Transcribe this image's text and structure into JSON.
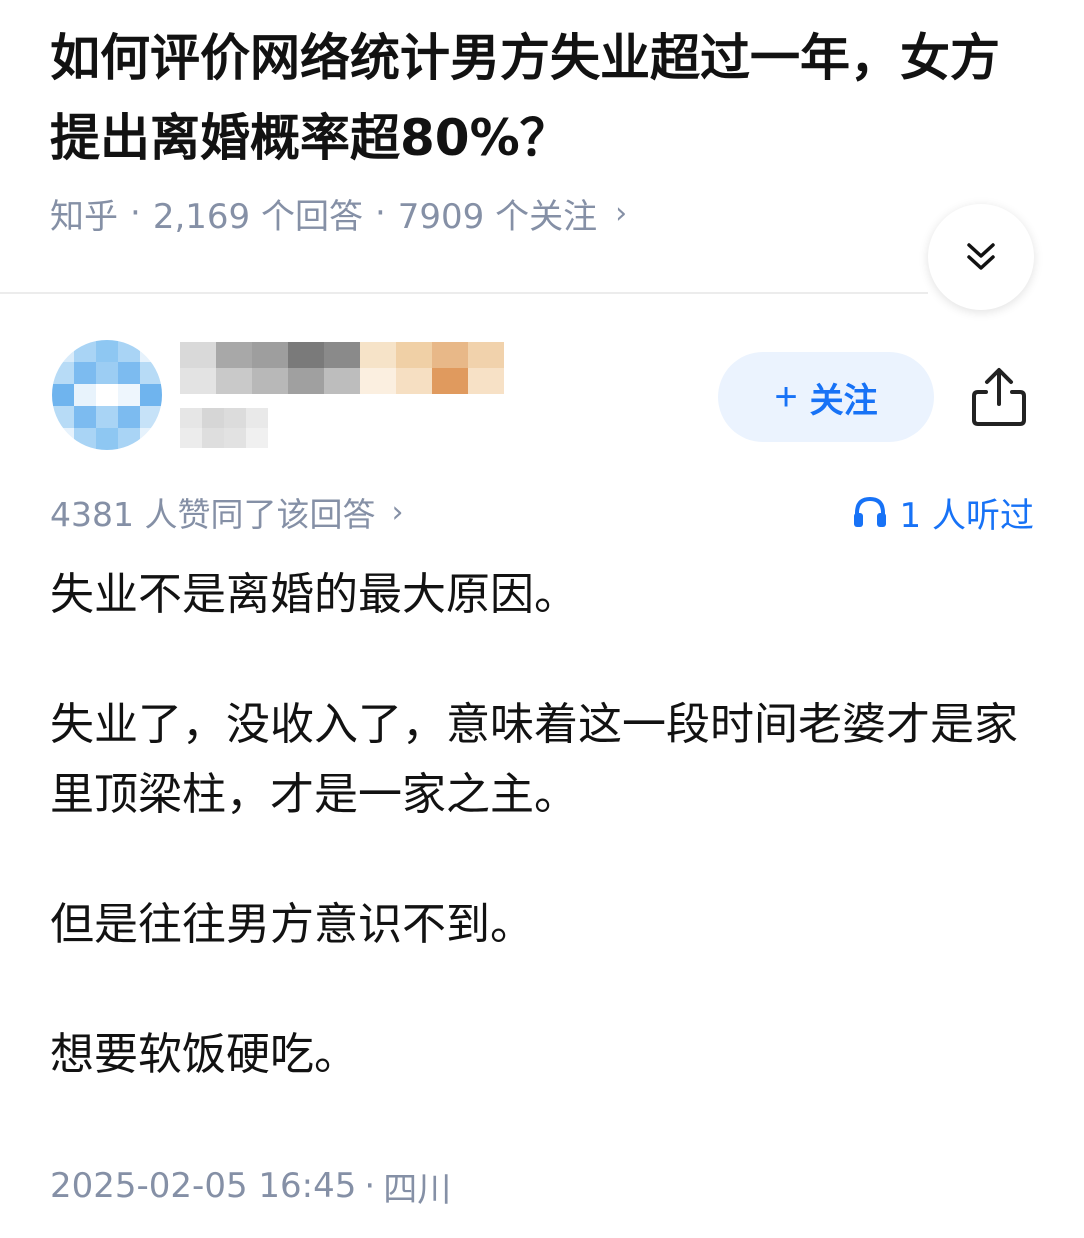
{
  "question": {
    "title": "如何评价网络统计男方失业超过一年，女方提出离婚概率超80%？",
    "source": "知乎",
    "answers": "2,169 个回答",
    "followers": "7909 个关注",
    "separator": "·",
    "chevron": "›"
  },
  "author": {
    "avatar_colors": [
      "#d8ebfa",
      "#a9d4f5",
      "#8ec7f2",
      "#a9d4f5",
      "#e6f2fc",
      "#b7dbf6",
      "#7cbbf0",
      "#9ccdf3",
      "#7cbbf0",
      "#b7dbf6",
      "#6fb4ee",
      "#e8f3fc",
      "#ffffff",
      "#eef6fd",
      "#6fb4ee",
      "#b7dbf6",
      "#7cbbf0",
      "#a9d4f5",
      "#7cbbf0",
      "#c6e2f8",
      "#e6f2fc",
      "#a9d4f5",
      "#8ec7f2",
      "#a9d4f5",
      "#e6f2fc"
    ],
    "name_colors": [
      "#d9d9d9",
      "#a8a8a8",
      "#9e9e9e",
      "#7a7a7a",
      "#8a8a8a",
      "#f6e3c8",
      "#f0d0a6",
      "#e8b888",
      "#f1d2ac",
      "#e3e3e3",
      "#c9c9c9",
      "#b8b8b8",
      "#a0a0a0",
      "#bdbdbd",
      "#fbefe0",
      "#f6dfc2",
      "#e09a5e",
      "#f7e1c6"
    ],
    "sub_colors": [
      "#e6e6e6",
      "#d6d6d6",
      "#dcdcdc",
      "#e9e9e9",
      "#ececec",
      "#dedede",
      "#e2e2e2",
      "#f0f0f0"
    ],
    "follow_label": "关注",
    "follow_plus": "+"
  },
  "stats": {
    "votes": "4381 人赞同了该回答",
    "chevron": "›",
    "listened": "1 人听过"
  },
  "answer": {
    "paragraphs": [
      "失业不是离婚的最大原因。",
      "失业了，没收入了，意味着这一段时间老婆才是家里顶梁柱，才是一家之主。",
      "但是往往男方意识不到。",
      "想要软饭硬吃。"
    ]
  },
  "footer": {
    "timestamp": "2025-02-05 16:45",
    "separator": "·",
    "location": "四川"
  },
  "colors": {
    "accent": "#1772f6",
    "follow_bg": "#ebf3fe",
    "meta_gray": "#8590a6",
    "text": "#121212"
  },
  "icons": {
    "expand": "double-chevron-down-icon",
    "share": "share-icon",
    "listen": "headphones-icon"
  }
}
